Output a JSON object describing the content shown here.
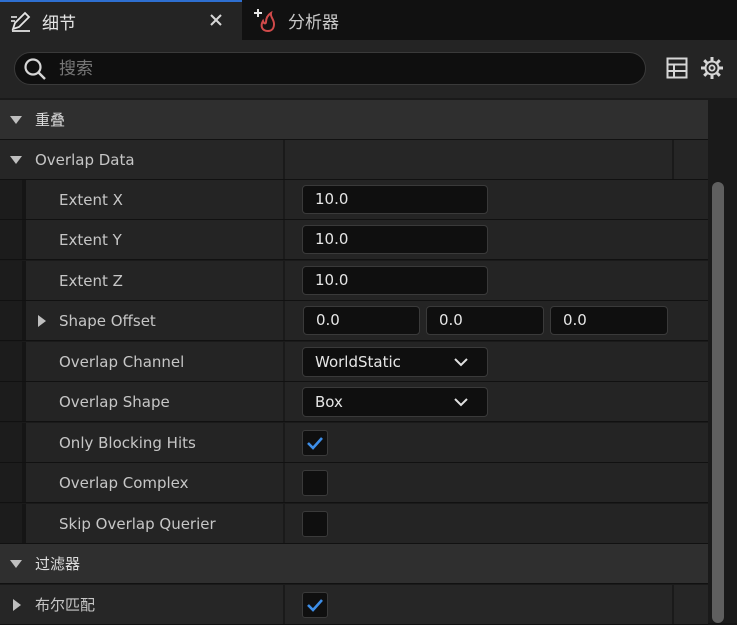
{
  "tabs": {
    "details_label": "细节",
    "profiler_label": "分析器"
  },
  "search": {
    "placeholder": "搜索"
  },
  "categories": {
    "overlap": "重叠",
    "overlap_data": "Overlap Data",
    "filter": "过滤器",
    "bool_match": "布尔匹配"
  },
  "properties": {
    "extent_x": {
      "label": "Extent X",
      "value": "10.0"
    },
    "extent_y": {
      "label": "Extent Y",
      "value": "10.0"
    },
    "extent_z": {
      "label": "Extent Z",
      "value": "10.0"
    },
    "shape_offset": {
      "label": "Shape Offset",
      "x": "0.0",
      "y": "0.0",
      "z": "0.0"
    },
    "overlap_channel": {
      "label": "Overlap Channel",
      "value": "WorldStatic"
    },
    "overlap_shape": {
      "label": "Overlap Shape",
      "value": "Box"
    },
    "only_blocking_hits": {
      "label": "Only Blocking Hits",
      "checked": true
    },
    "overlap_complex": {
      "label": "Overlap Complex",
      "checked": false
    },
    "skip_overlap_querier": {
      "label": "Skip Overlap Querier",
      "checked": false
    },
    "bool_match_checked": true
  },
  "colors": {
    "accent": "#2e6fd0",
    "check": "#3d8ee8",
    "profiler_icon": "#d04a4a"
  }
}
